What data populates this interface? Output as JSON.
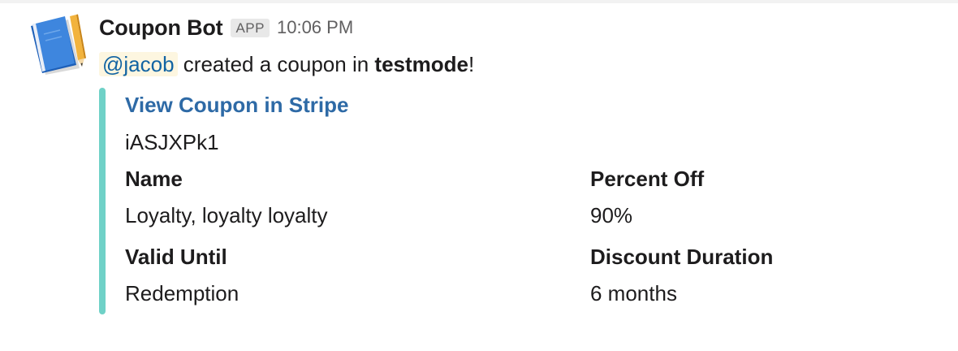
{
  "message": {
    "sender": "Coupon Bot",
    "badge": "APP",
    "timestamp": "10:06 PM",
    "mention": "@jacob",
    "text_middle": " created a coupon in ",
    "text_bold": "testmode",
    "text_end": "!"
  },
  "attachment": {
    "color": "#6fd1c7",
    "title": "View Coupon in Stripe",
    "text": "iASJXPk1",
    "fields": [
      {
        "title": "Name",
        "value": "Loyalty, loyalty loyalty"
      },
      {
        "title": "Percent Off",
        "value": "90%"
      },
      {
        "title": "Valid Until",
        "value": "Redemption"
      },
      {
        "title": "Discount Duration",
        "value": "6 months"
      }
    ]
  },
  "avatar": {
    "icon": "notebook-pencil-icon"
  }
}
